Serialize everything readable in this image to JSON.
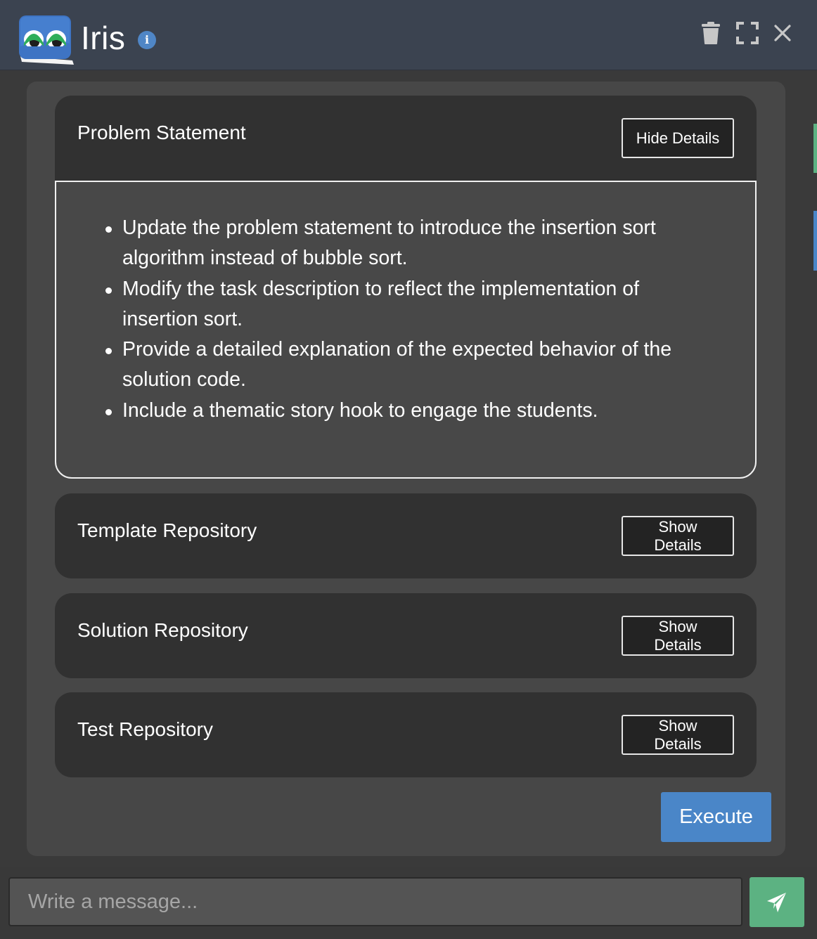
{
  "header": {
    "title": "Iris",
    "logo_icon": "iris-logo-icon",
    "info_icon": "info-icon",
    "info_glyph": "i",
    "actions": [
      {
        "name": "trash-icon"
      },
      {
        "name": "fullscreen-icon"
      },
      {
        "name": "close-icon"
      }
    ]
  },
  "cards": [
    {
      "title": "Problem Statement",
      "button_label": "Hide Details",
      "expanded": true,
      "details": [
        "Update the problem statement to introduce the insertion sort algorithm instead of bubble sort.",
        "Modify the task description to reflect the implementation of insertion sort.",
        "Provide a detailed explanation of the expected behavior of the solution code.",
        "Include a thematic story hook to engage the students."
      ]
    },
    {
      "title": "Template Repository",
      "button_label": "Show Details",
      "expanded": false
    },
    {
      "title": "Solution Repository",
      "button_label": "Show Details",
      "expanded": false
    },
    {
      "title": "Test Repository",
      "button_label": "Show Details",
      "expanded": false
    }
  ],
  "execute_label": "Execute",
  "composer": {
    "placeholder": "Write a message...",
    "value": "",
    "send_icon": "paper-plane-icon"
  },
  "colors": {
    "header_bg": "#3b4350",
    "panel_bg": "#474747",
    "card_bg": "#313131",
    "accent_blue": "#4a86c8",
    "send_green": "#5cb282"
  }
}
